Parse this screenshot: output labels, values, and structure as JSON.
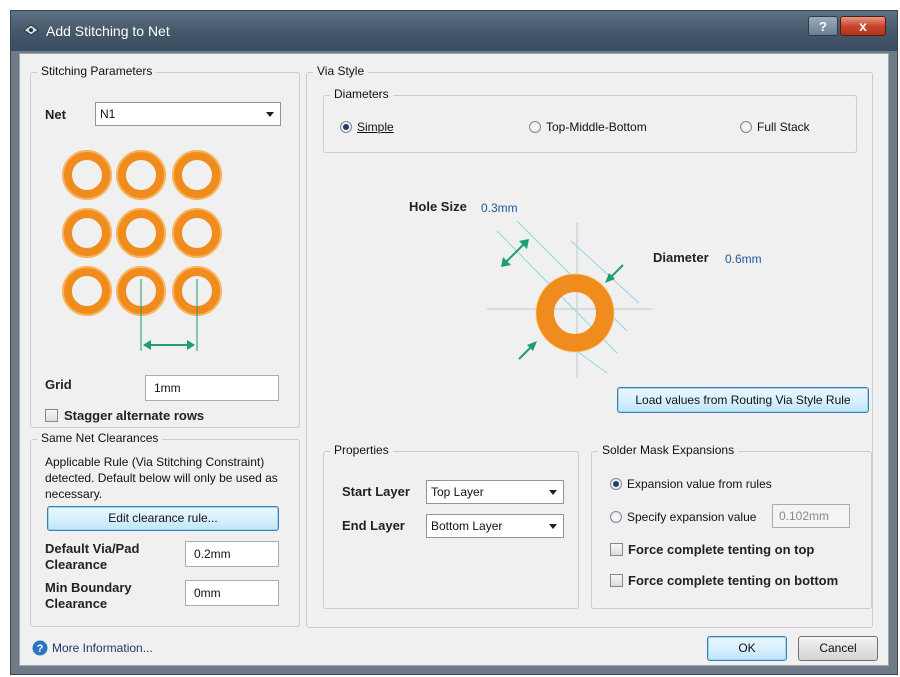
{
  "window": {
    "title": "Add Stitching to Net",
    "help_label": "?",
    "close_label": "x"
  },
  "stitching": {
    "group_label": "Stitching Parameters",
    "net_label": "Net",
    "net_value": "N1",
    "grid_label": "Grid",
    "grid_value": "1mm",
    "stagger_label": "Stagger alternate rows"
  },
  "clearances": {
    "group_label": "Same Net Clearances",
    "rule_text": "Applicable Rule (Via Stitching Constraint) detected. Default below will only be used as necessary.",
    "edit_button": "Edit clearance rule...",
    "default_label": "Default Via/Pad Clearance",
    "default_value": "0.2mm",
    "min_label": "Min Boundary Clearance",
    "min_value": "0mm"
  },
  "via_style": {
    "group_label": "Via Style",
    "diameters_label": "Diameters",
    "radio_simple": "Simple",
    "radio_tmb": "Top-Middle-Bottom",
    "radio_full": "Full Stack",
    "selected": "Simple",
    "hole_size_label": "Hole Size",
    "hole_size_value": "0.3mm",
    "diameter_label": "Diameter",
    "diameter_value": "0.6mm",
    "load_button": "Load values from Routing Via Style Rule"
  },
  "properties": {
    "group_label": "Properties",
    "start_layer_label": "Start Layer",
    "start_layer_value": "Top Layer",
    "end_layer_label": "End Layer",
    "end_layer_value": "Bottom Layer"
  },
  "solder_mask": {
    "group_label": "Solder Mask Expansions",
    "from_rules_label": "Expansion value from rules",
    "specify_label": "Specify expansion value",
    "specify_value": "0.102mm",
    "selected": "Expansion value from rules",
    "tent_top_label": "Force complete tenting on top",
    "tent_bottom_label": "Force complete tenting on bottom"
  },
  "footer": {
    "more_info": "More Information...",
    "ok": "OK",
    "cancel": "Cancel"
  },
  "colors": {
    "via_ring": "#f08c1e",
    "accent_arrow": "#1f9e6e",
    "link_blue": "#1b5c99"
  }
}
